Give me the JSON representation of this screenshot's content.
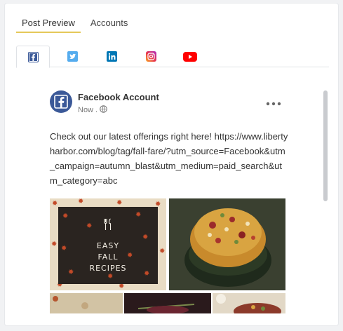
{
  "tabs": {
    "post_preview": "Post Preview",
    "accounts": "Accounts"
  },
  "social_tabs": [
    {
      "name": "facebook",
      "color": "#3b5998"
    },
    {
      "name": "twitter",
      "color": "#55acee"
    },
    {
      "name": "linkedin",
      "color": "#0077b5"
    },
    {
      "name": "instagram",
      "color": "#d6249f"
    },
    {
      "name": "youtube",
      "color": "#ff0000"
    }
  ],
  "post": {
    "account_name": "Facebook Account",
    "time": "Now .",
    "text": "Check out our latest offerings right here! https://www.libertyharbor.com/blog/tag/fall-fare/?utm_source=Facebook&utm_campaign=autumn_blast&utm_medium=paid_search&utm_category=abc",
    "image_title_lines": [
      "EASY",
      "FALL",
      "RECIPES"
    ]
  }
}
